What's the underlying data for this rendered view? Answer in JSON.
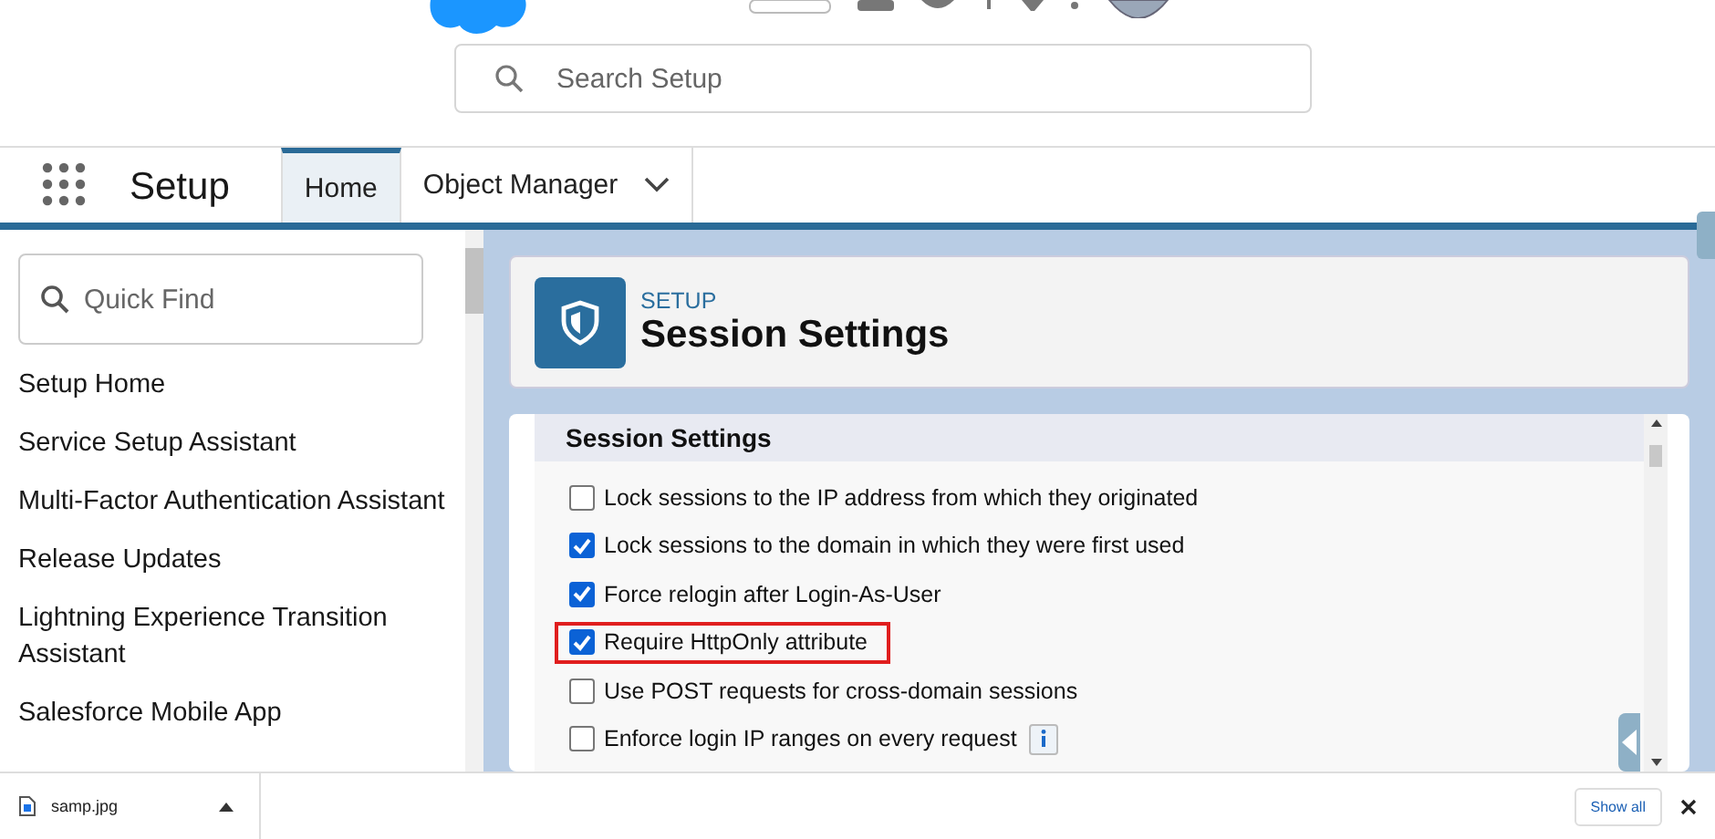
{
  "header": {
    "search": {
      "placeholder": "Search Setup"
    }
  },
  "nav": {
    "app_name": "Setup",
    "tabs": [
      {
        "label": "Home",
        "selected": true,
        "dropdown": false
      },
      {
        "label": "Object Manager",
        "selected": false,
        "dropdown": true
      }
    ]
  },
  "sidebar": {
    "search": {
      "placeholder": "Quick Find"
    },
    "items": [
      "Setup Home",
      "Service Setup Assistant",
      "Multi-Factor Authentication Assistant",
      "Release Updates",
      "Lightning Experience Transition Assistant",
      "Salesforce Mobile App"
    ]
  },
  "page_header": {
    "eyebrow": "SETUP",
    "title": "Session Settings"
  },
  "section": {
    "title": "Session Settings",
    "options": [
      {
        "label": "Lock sessions to the IP address from which they originated",
        "checked": false,
        "highlighted": false,
        "info": false
      },
      {
        "label": "Lock sessions to the domain in which they were first used",
        "checked": true,
        "highlighted": false,
        "info": false
      },
      {
        "label": "Force relogin after Login-As-User",
        "checked": true,
        "highlighted": false,
        "info": false
      },
      {
        "label": "Require HttpOnly attribute",
        "checked": true,
        "highlighted": true,
        "info": false
      },
      {
        "label": "Use POST requests for cross-domain sessions",
        "checked": false,
        "highlighted": false,
        "info": false
      },
      {
        "label": "Enforce login IP ranges on every request",
        "checked": false,
        "highlighted": false,
        "info": true
      }
    ]
  },
  "download_bar": {
    "file": "samp.jpg",
    "show_all": "Show all"
  }
}
